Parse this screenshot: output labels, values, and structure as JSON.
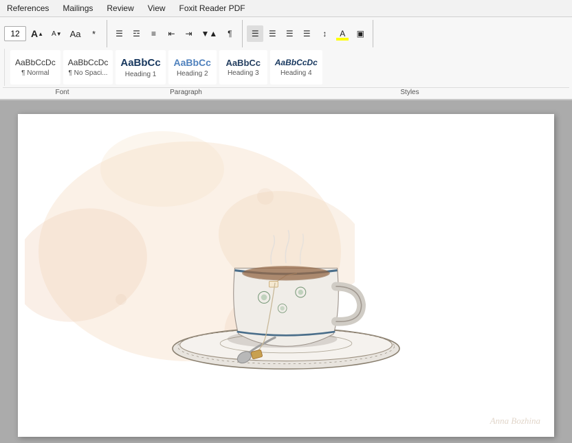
{
  "menubar": {
    "items": [
      "References",
      "Mailings",
      "Review",
      "View",
      "Foxit Reader PDF"
    ]
  },
  "ribbon": {
    "font_size": "12",
    "font_size_placeholder": "12",
    "groups": {
      "font_label": "Font",
      "paragraph_label": "Paragraph",
      "styles_label": "Styles"
    },
    "styles": [
      {
        "id": "normal",
        "preview_text": "AaBbCcDc",
        "preview_class": "normal",
        "label": "¶ Normal",
        "font_size": "11"
      },
      {
        "id": "no-spacing",
        "preview_text": "AaBbCcDc",
        "preview_class": "no-spacing",
        "label": "¶ No Spaci...",
        "font_size": "11"
      },
      {
        "id": "heading1",
        "preview_text": "AaBbCc",
        "preview_class": "heading1",
        "label": "Heading 1",
        "font_size": "14"
      },
      {
        "id": "heading2",
        "preview_text": "AaBbCc",
        "preview_class": "heading2",
        "label": "Heading 2",
        "font_size": "13"
      },
      {
        "id": "heading3",
        "preview_text": "AaBbCc",
        "preview_class": "heading3",
        "label": "Heading 3",
        "font_size": "12"
      },
      {
        "id": "heading4",
        "preview_text": "AaBbCcDc",
        "preview_class": "heading4",
        "label": "Heading 4",
        "font_size": "11"
      }
    ]
  },
  "document": {
    "content": "Tea cup image"
  }
}
